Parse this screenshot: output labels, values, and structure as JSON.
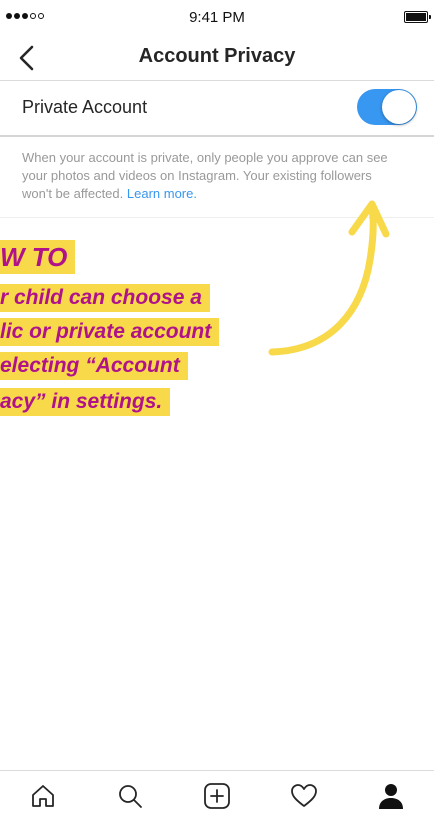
{
  "status_bar": {
    "time": "9:41 PM"
  },
  "nav": {
    "title": "Account Privacy",
    "back_icon": "chevron-left-icon"
  },
  "private_account": {
    "label": "Private Account",
    "enabled": true,
    "toggle_color": "#3897f0"
  },
  "description": {
    "text": "When your account is private, only people you approve can see your photos and videos on Instagram. Your existing followers won't be affected.",
    "link": "Learn more."
  },
  "annotation": {
    "lines": [
      "W TO",
      "r child can choose a",
      "lic or private account",
      "electing “Account",
      "acy” in settings."
    ],
    "highlight_color": "#f7d94a",
    "text_color": "#b0128a"
  },
  "tab_bar": {
    "items": [
      {
        "name": "home",
        "icon": "home-icon"
      },
      {
        "name": "search",
        "icon": "search-icon"
      },
      {
        "name": "new-post",
        "icon": "plus-square-icon"
      },
      {
        "name": "activity",
        "icon": "heart-icon"
      },
      {
        "name": "profile",
        "icon": "person-icon"
      }
    ]
  },
  "background_color": "#e6007e"
}
